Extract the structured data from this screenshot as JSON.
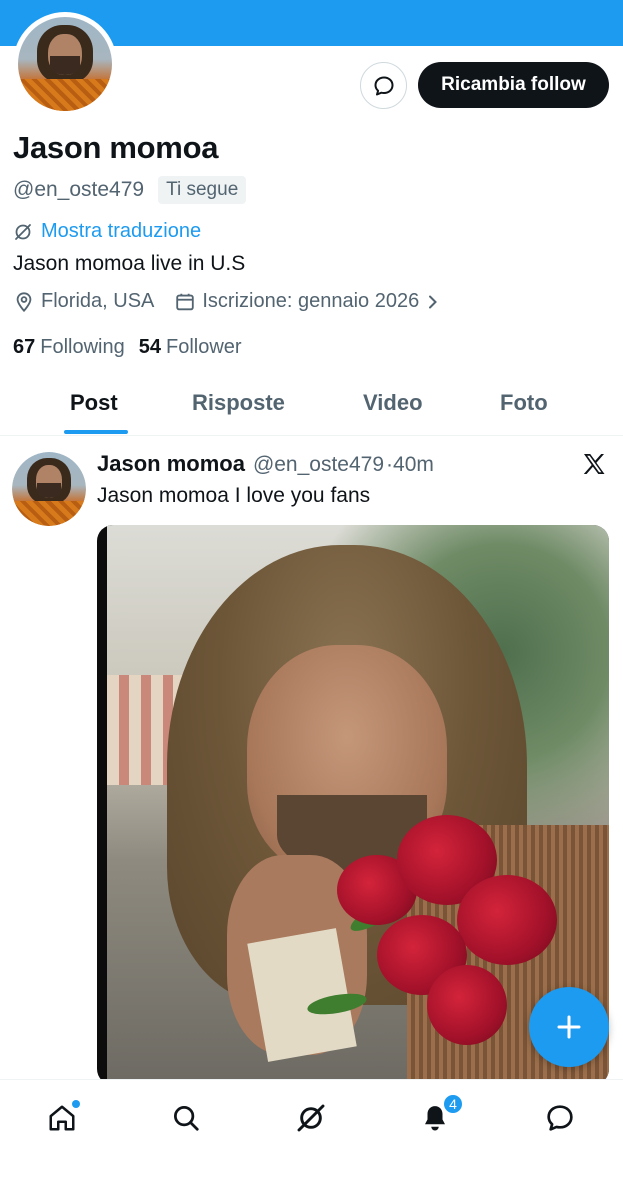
{
  "profile": {
    "name": "Jason momoa",
    "handle": "@en_oste479",
    "follows_you_badge": "Ti segue",
    "translate_link": "Mostra traduzione",
    "bio": "Jason momoa live in U.S",
    "location": "Florida, USA",
    "joined": "Iscrizione: gennaio 2026",
    "following_count": "67",
    "following_label": "Following",
    "followers_count": "54",
    "followers_label": "Follower",
    "follow_back_button": "Ricambia follow"
  },
  "tabs": [
    {
      "label": "Post",
      "active": true
    },
    {
      "label": "Risposte",
      "active": false
    },
    {
      "label": "Video",
      "active": false
    },
    {
      "label": "Foto",
      "active": false
    }
  ],
  "tweet": {
    "name": "Jason momoa",
    "handle": "@en_oste479",
    "time": "·40m",
    "text": "Jason momoa I love you fans"
  },
  "fab": {
    "icon": "plus-icon"
  },
  "bottom_nav": {
    "items": [
      "home-icon",
      "search-icon",
      "grok-icon",
      "bell-icon",
      "messages-icon"
    ],
    "notification_count": "4"
  },
  "colors": {
    "accent": "#1d9bf0",
    "text": "#0f1419",
    "secondary": "#536471"
  }
}
